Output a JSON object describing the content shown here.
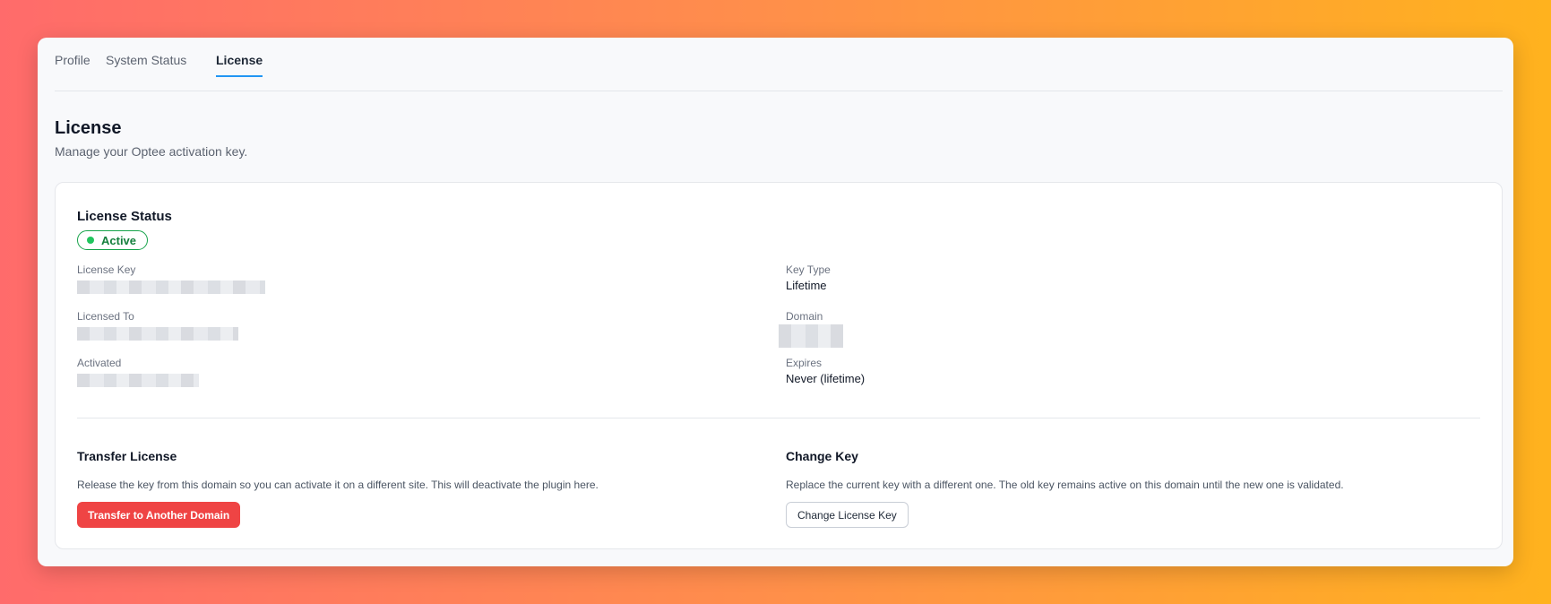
{
  "tabs": [
    {
      "label": "Profile"
    },
    {
      "label": "System Status"
    },
    {
      "label": "License"
    }
  ],
  "active_tab": "License",
  "page": {
    "title": "License",
    "subtitle": "Manage your Optee activation key."
  },
  "license_status": {
    "title": "License Status",
    "badge": "Active",
    "badge_color": "#16a34a"
  },
  "fields": {
    "license_key": {
      "label": "License Key"
    },
    "licensed_to": {
      "label": "Licensed To"
    },
    "activated": {
      "label": "Activated"
    },
    "key_type": {
      "label": "Key Type",
      "value": "Lifetime"
    },
    "domain": {
      "label": "Domain"
    },
    "expires": {
      "label": "Expires",
      "value": "Never (lifetime)"
    }
  },
  "transfer": {
    "title": "Transfer License",
    "description": "Release the key from this domain so you can activate it on a different site. This will deactivate the plugin here.",
    "button_label": "Transfer to Another Domain",
    "button_color": "#ef4444"
  },
  "change_key": {
    "title": "Change Key",
    "description": "Replace the current key with a different one. The old key remains active on this domain until the new one is validated.",
    "button_label": "Change License Key"
  },
  "accent_color": "#2196f3"
}
